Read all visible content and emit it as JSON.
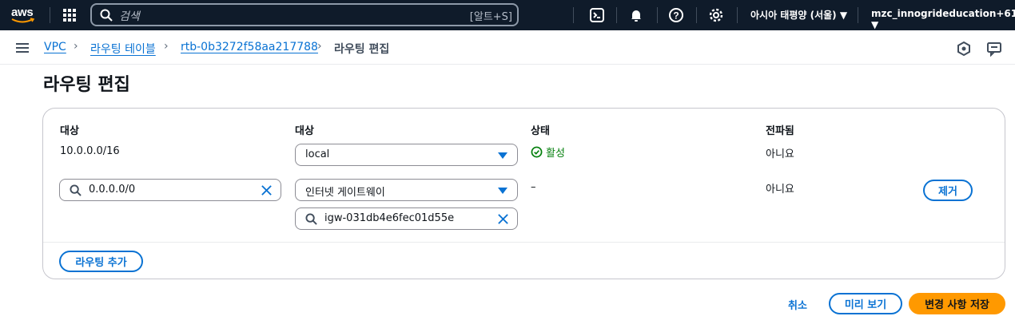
{
  "topnav": {
    "logo": "aws",
    "search_placeholder": "검색",
    "search_shortcut": "[알트+S]",
    "region": "아시아 태평양 (서울) ▼",
    "account": "mzc_innogrideducation+61 ▼",
    "icons": [
      "grid-icon",
      "cloudshell-icon",
      "bell-icon",
      "help-icon",
      "settings-icon"
    ]
  },
  "breadcrumb": {
    "items": [
      "VPC",
      "라우팅 테이블",
      "rtb-0b3272f58aa217788"
    ],
    "current": "라우팅 편집",
    "separator": "›"
  },
  "page": {
    "title": "라우팅 편집"
  },
  "table": {
    "headers": [
      "대상",
      "대상",
      "상태",
      "전파됨"
    ],
    "rows": [
      {
        "destination": "10.0.0.0/16",
        "target": "local",
        "status": "활성",
        "propagated": "아니요"
      },
      {
        "destination": "0.0.0.0/0",
        "target": "인터넷 게이트웨이",
        "target_id": "igw-031db4e6fec01d55e",
        "status": "–",
        "propagated": "아니요",
        "remove_label": "제거"
      }
    ]
  },
  "actions": {
    "add_route": "라우팅 추가",
    "cancel": "취소",
    "preview": "미리 보기",
    "save": "변경 사항 저장"
  },
  "colors": {
    "nav_bg": "#0f1b2a",
    "link": "#0972d3",
    "primary": "#ff9900",
    "success": "#037f0c"
  }
}
